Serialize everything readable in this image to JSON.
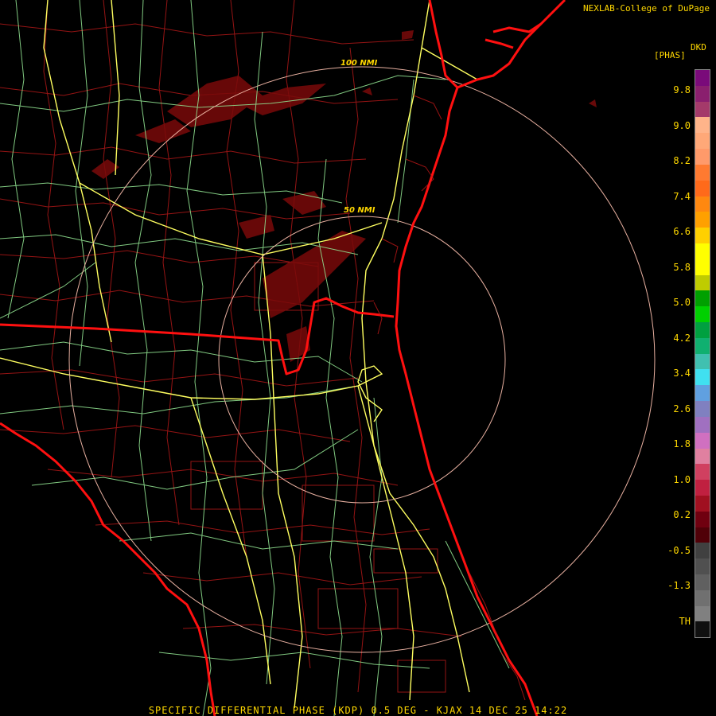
{
  "credit": "NEXLAB-College of DuPage",
  "product_code": "DKD",
  "unit": "[PHAS]",
  "range_rings": [
    {
      "label": "50 NMI",
      "nmi": 50
    },
    {
      "label": "100 NMI",
      "nmi": 100
    }
  ],
  "legend": {
    "ticks": [
      "9.8",
      "9.0",
      "8.2",
      "7.4",
      "6.6",
      "5.8",
      "5.0",
      "4.2",
      "3.4",
      "2.6",
      "1.8",
      "1.0",
      "0.2",
      "-0.5",
      "-1.3",
      "TH"
    ],
    "colors": [
      "#7a0a7a",
      "#8a1f6e",
      "#a43a6a",
      "#ffb48a",
      "#ffa878",
      "#ff9a6a",
      "#ff7a30",
      "#ff6a1a",
      "#ff8810",
      "#ffa000",
      "#ffd000",
      "#ffff00",
      "#ffff00",
      "#bfcc00",
      "#00a000",
      "#00d000",
      "#00a040",
      "#10b070",
      "#40c0b0",
      "#40e0f0",
      "#60a0e0",
      "#8080c0",
      "#a070c0",
      "#d070c0",
      "#e080a0",
      "#d04060",
      "#c02040",
      "#a01020",
      "#700010",
      "#500008",
      "#404040",
      "#505050",
      "#606060",
      "#707070",
      "#808080",
      "#101010"
    ]
  },
  "caption": "SPECIFIC DIFFERENTIAL PHASE (KDP) 0.5 DEG - KJAX 14 DEC 25 14:22",
  "colors": {
    "state_border": "#ff1010",
    "county_line": "#c01818",
    "highway": "#ffff60",
    "road": "#90e090",
    "range_ring": "#e8b0a0",
    "echo": "#7a0a0a"
  }
}
